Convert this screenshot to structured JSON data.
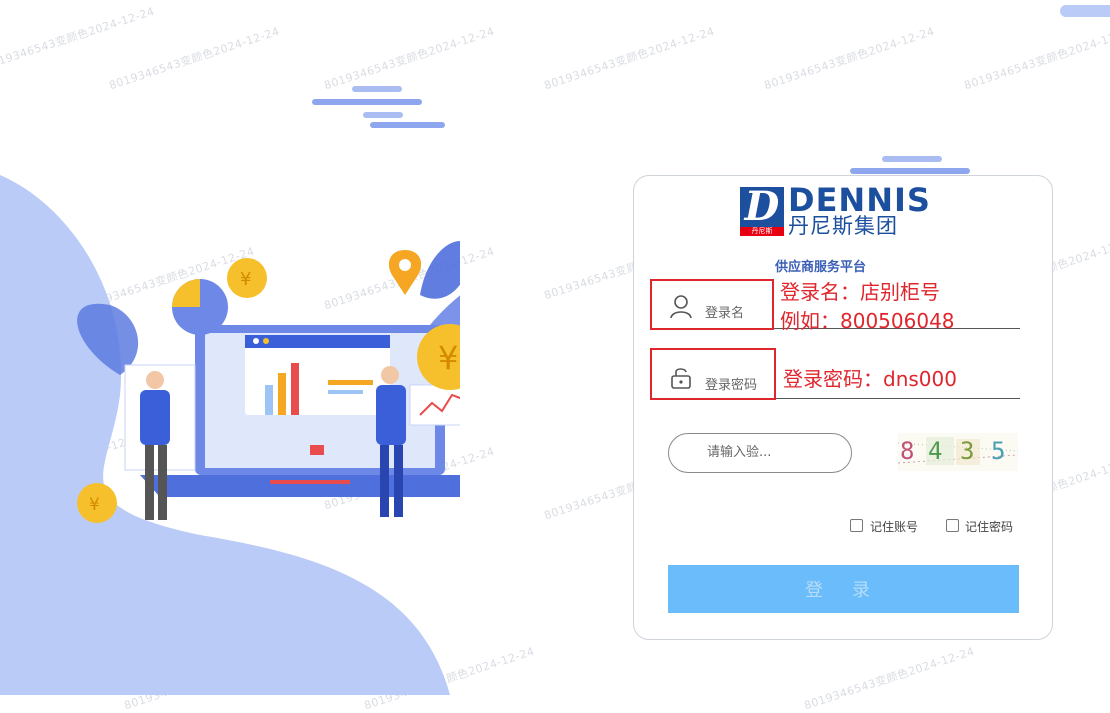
{
  "watermark": "8019346543变颜色2024-12-24",
  "brand": {
    "logo_letter": "D",
    "logo_sub": "丹尼斯",
    "name_en": "DENNIS",
    "name_cn": "丹尼斯集团",
    "color": "#1c4f9e"
  },
  "subtitle": "供应商服务平台",
  "username": {
    "placeholder": "登录名",
    "icon": "user-icon"
  },
  "password": {
    "placeholder": "登录密码",
    "icon": "unlock-icon"
  },
  "annotations": {
    "username_hint_line1": "登录名：店别柜号",
    "username_hint_line2": "例如：800506048",
    "password_hint": "登录密码：dns000",
    "color": "#e0262d"
  },
  "captcha": {
    "placeholder": "请输入验...",
    "digits": [
      "8",
      "4",
      "3",
      "5"
    ],
    "digit_colors": [
      "#c0507a",
      "#4f9a4f",
      "#7a9a3a",
      "#4aa0b0"
    ]
  },
  "remember_account": "记住账号",
  "remember_password": "记住密码",
  "login_button": "登 录",
  "colors": {
    "button": "#6abcfa",
    "illustration": "#b9cbf6",
    "accent": "#3b5fd9"
  }
}
